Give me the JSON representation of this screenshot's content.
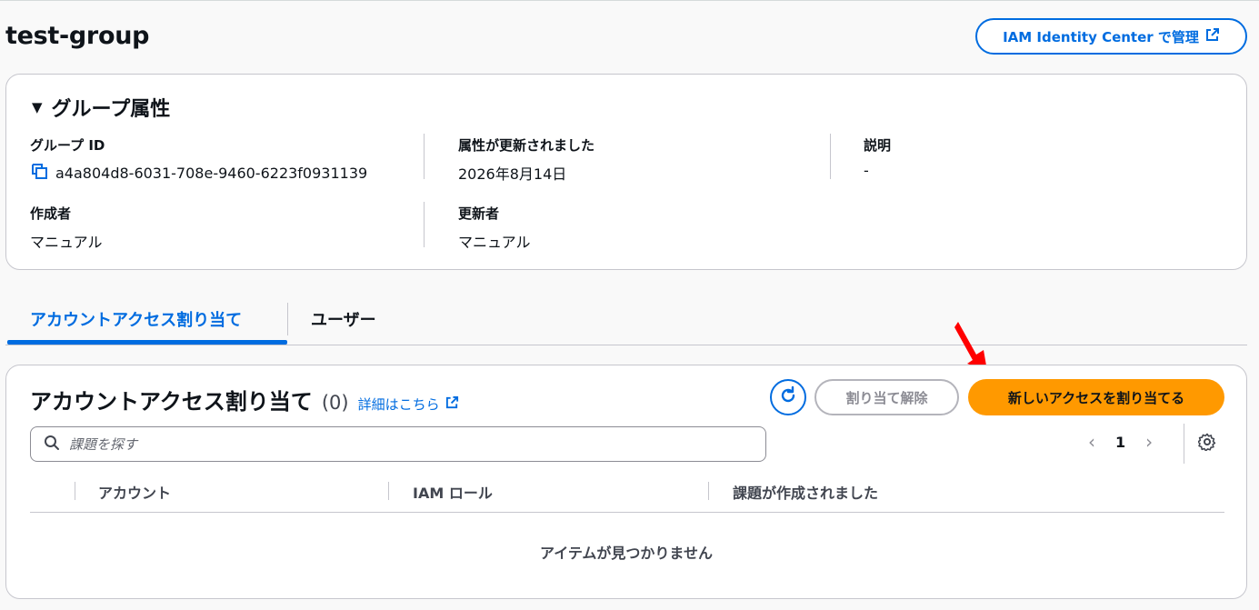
{
  "page": {
    "title": "test-group"
  },
  "header": {
    "manage_button": "IAM Identity Center で管理"
  },
  "group_properties": {
    "heading": "グループ属性",
    "group_id_label": "グループ ID",
    "group_id_value": "a4a804d8-6031-708e-9460-6223f0931139",
    "updated_label": "属性が更新されました",
    "updated_value": "2026年8月14日",
    "description_label": "説明",
    "description_value": "-",
    "created_by_label": "作成者",
    "created_by_value": "マニュアル",
    "updated_by_label": "更新者",
    "updated_by_value": "マニュアル"
  },
  "tabs": [
    {
      "label": "アカウントアクセス割り当て",
      "active": true
    },
    {
      "label": "ユーザー",
      "active": false
    }
  ],
  "assignments": {
    "title": "アカウントアクセス割り当て",
    "count": "(0)",
    "detail_link": "詳細はこちら",
    "unassign_button": "割り当て解除",
    "new_access_button": "新しいアクセスを割り当てる",
    "search_placeholder": "課題を探す",
    "page_number": "1",
    "columns": [
      "アカウント",
      "IAM ロール",
      "課題が作成されました"
    ],
    "empty_message": "アイテムが見つかりません"
  },
  "colors": {
    "accent": "#006ce0",
    "primary_button": "#ff9900",
    "annotation_arrow": "#ff0000"
  }
}
